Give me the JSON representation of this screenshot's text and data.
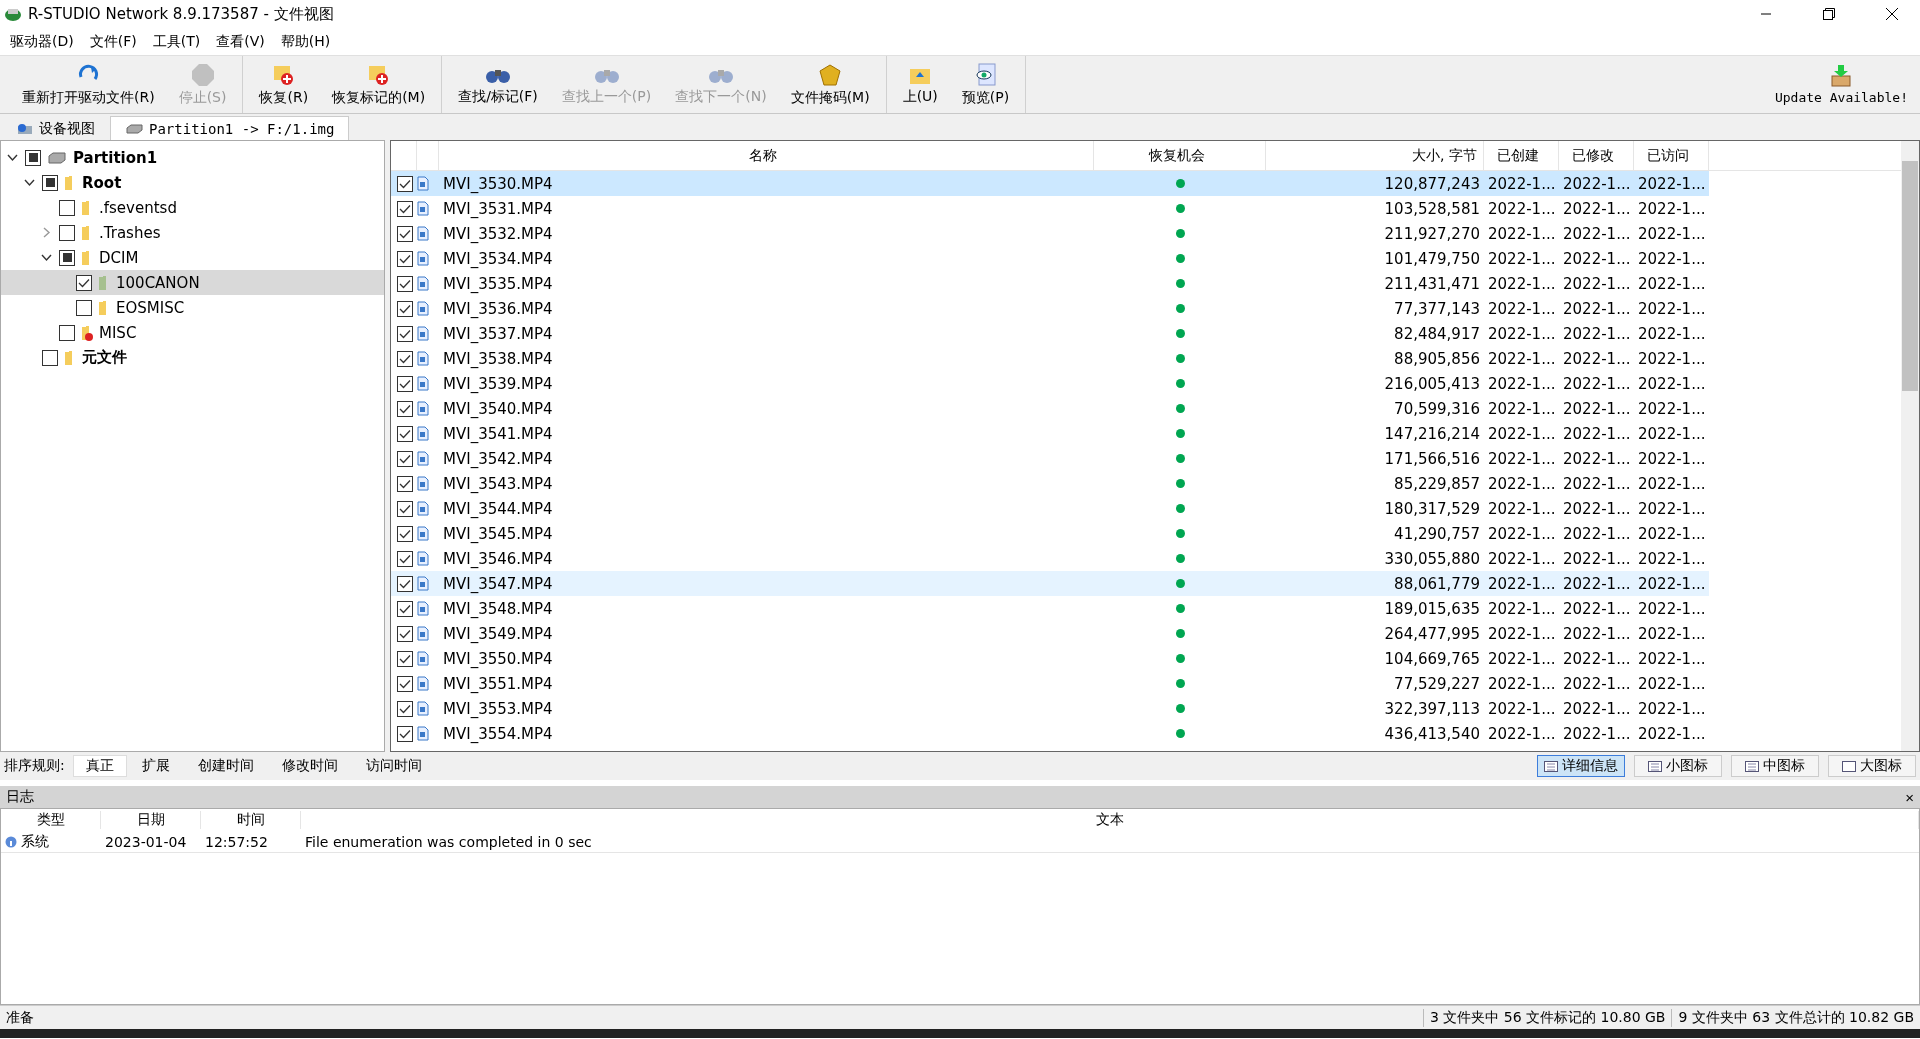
{
  "window": {
    "title": "R-STUDIO Network 8.9.173587 - 文件视图"
  },
  "menu": [
    "驱动器(D)",
    "文件(F)",
    "工具(T)",
    "查看(V)",
    "帮助(H)"
  ],
  "toolbar": [
    [
      {
        "label": "重新打开驱动文件(R)",
        "disabled": false
      },
      {
        "label": "停止(S)",
        "disabled": true
      }
    ],
    [
      {
        "label": "恢复(R)",
        "disabled": false
      },
      {
        "label": "恢复标记的(M)",
        "disabled": false
      }
    ],
    [
      {
        "label": "查找/标记(F)",
        "disabled": false
      },
      {
        "label": "查找上一个(P)",
        "disabled": true
      },
      {
        "label": "查找下一个(N)",
        "disabled": true
      },
      {
        "label": "文件掩码(M)",
        "disabled": false
      }
    ],
    [
      {
        "label": "上(U)",
        "disabled": false
      },
      {
        "label": "预览(P)",
        "disabled": false
      }
    ]
  ],
  "update": {
    "label": "Update Available!"
  },
  "tabs": [
    {
      "label": "设备视图",
      "selected": false
    },
    {
      "label": "Partition1 -> F:/1.img",
      "selected": true
    }
  ],
  "tree": [
    {
      "label": "Partition1",
      "bold": true,
      "kind": "drive",
      "checked": false,
      "partial": true,
      "expanded": true,
      "selected": false,
      "children": [
        {
          "label": "Root",
          "bold": true,
          "kind": "folder",
          "checked": false,
          "partial": true,
          "expanded": true,
          "selected": false,
          "children": [
            {
              "label": ".fseventsd",
              "bold": false,
              "kind": "folder",
              "checked": false,
              "partial": false,
              "selected": false
            },
            {
              "label": ".Trashes",
              "bold": false,
              "kind": "folder",
              "checked": false,
              "partial": false,
              "expanded": false,
              "selected": false
            },
            {
              "label": "DCIM",
              "bold": false,
              "kind": "folder",
              "checked": false,
              "partial": true,
              "expanded": true,
              "selected": false,
              "children": [
                {
                  "label": "100CANON",
                  "bold": false,
                  "kind": "folder-green",
                  "checked": true,
                  "partial": false,
                  "selected": true
                },
                {
                  "label": "EOSMISC",
                  "bold": false,
                  "kind": "folder",
                  "checked": false,
                  "partial": false,
                  "selected": false
                }
              ]
            },
            {
              "label": "MISC",
              "bold": false,
              "kind": "folder-unknown",
              "checked": false,
              "partial": false,
              "selected": false
            }
          ]
        },
        {
          "label": "元文件",
          "bold": true,
          "kind": "folder",
          "checked": false,
          "partial": false,
          "selected": false
        }
      ]
    }
  ],
  "table": {
    "columns": [
      "名称",
      "恢复机会",
      "大小, 字节",
      "已创建",
      "已修改",
      "已访问"
    ],
    "rows": [
      {
        "name": "MVI_3530.MP4",
        "color": "#00a651",
        "size": "120,877,243",
        "created": "2022-1...",
        "modified": "2022-1...",
        "accessed": "2022-1...",
        "checked": true,
        "selected": true,
        "highlighted": false
      },
      {
        "name": "MVI_3531.MP4",
        "color": "#00a651",
        "size": "103,528,581",
        "created": "2022-1...",
        "modified": "2022-1...",
        "accessed": "2022-1...",
        "checked": true,
        "selected": false,
        "highlighted": false
      },
      {
        "name": "MVI_3532.MP4",
        "color": "#00a651",
        "size": "211,927,270",
        "created": "2022-1...",
        "modified": "2022-1...",
        "accessed": "2022-1...",
        "checked": true,
        "selected": false,
        "highlighted": false
      },
      {
        "name": "MVI_3534.MP4",
        "color": "#00a651",
        "size": "101,479,750",
        "created": "2022-1...",
        "modified": "2022-1...",
        "accessed": "2022-1...",
        "checked": true,
        "selected": false,
        "highlighted": false
      },
      {
        "name": "MVI_3535.MP4",
        "color": "#00a651",
        "size": "211,431,471",
        "created": "2022-1...",
        "modified": "2022-1...",
        "accessed": "2022-1...",
        "checked": true,
        "selected": false,
        "highlighted": false
      },
      {
        "name": "MVI_3536.MP4",
        "color": "#00a651",
        "size": "77,377,143",
        "created": "2022-1...",
        "modified": "2022-1...",
        "accessed": "2022-1...",
        "checked": true,
        "selected": false,
        "highlighted": false
      },
      {
        "name": "MVI_3537.MP4",
        "color": "#00a651",
        "size": "82,484,917",
        "created": "2022-1...",
        "modified": "2022-1...",
        "accessed": "2022-1...",
        "checked": true,
        "selected": false,
        "highlighted": false
      },
      {
        "name": "MVI_3538.MP4",
        "color": "#00a651",
        "size": "88,905,856",
        "created": "2022-1...",
        "modified": "2022-1...",
        "accessed": "2022-1...",
        "checked": true,
        "selected": false,
        "highlighted": false
      },
      {
        "name": "MVI_3539.MP4",
        "color": "#00a651",
        "size": "216,005,413",
        "created": "2022-1...",
        "modified": "2022-1...",
        "accessed": "2022-1...",
        "checked": true,
        "selected": false,
        "highlighted": false
      },
      {
        "name": "MVI_3540.MP4",
        "color": "#00a651",
        "size": "70,599,316",
        "created": "2022-1...",
        "modified": "2022-1...",
        "accessed": "2022-1...",
        "checked": true,
        "selected": false,
        "highlighted": false
      },
      {
        "name": "MVI_3541.MP4",
        "color": "#00a651",
        "size": "147,216,214",
        "created": "2022-1...",
        "modified": "2022-1...",
        "accessed": "2022-1...",
        "checked": true,
        "selected": false,
        "highlighted": false
      },
      {
        "name": "MVI_3542.MP4",
        "color": "#00a651",
        "size": "171,566,516",
        "created": "2022-1...",
        "modified": "2022-1...",
        "accessed": "2022-1...",
        "checked": true,
        "selected": false,
        "highlighted": false
      },
      {
        "name": "MVI_3543.MP4",
        "color": "#00a651",
        "size": "85,229,857",
        "created": "2022-1...",
        "modified": "2022-1...",
        "accessed": "2022-1...",
        "checked": true,
        "selected": false,
        "highlighted": false
      },
      {
        "name": "MVI_3544.MP4",
        "color": "#00a651",
        "size": "180,317,529",
        "created": "2022-1...",
        "modified": "2022-1...",
        "accessed": "2022-1...",
        "checked": true,
        "selected": false,
        "highlighted": false
      },
      {
        "name": "MVI_3545.MP4",
        "color": "#00a651",
        "size": "41,290,757",
        "created": "2022-1...",
        "modified": "2022-1...",
        "accessed": "2022-1...",
        "checked": true,
        "selected": false,
        "highlighted": false
      },
      {
        "name": "MVI_3546.MP4",
        "color": "#00a651",
        "size": "330,055,880",
        "created": "2022-1...",
        "modified": "2022-1...",
        "accessed": "2022-1...",
        "checked": true,
        "selected": false,
        "highlighted": false
      },
      {
        "name": "MVI_3547.MP4",
        "color": "#00a651",
        "size": "88,061,779",
        "created": "2022-1...",
        "modified": "2022-1...",
        "accessed": "2022-1...",
        "checked": true,
        "selected": false,
        "highlighted": true
      },
      {
        "name": "MVI_3548.MP4",
        "color": "#00a651",
        "size": "189,015,635",
        "created": "2022-1...",
        "modified": "2022-1...",
        "accessed": "2022-1...",
        "checked": true,
        "selected": false,
        "highlighted": false
      },
      {
        "name": "MVI_3549.MP4",
        "color": "#00a651",
        "size": "264,477,995",
        "created": "2022-1...",
        "modified": "2022-1...",
        "accessed": "2022-1...",
        "checked": true,
        "selected": false,
        "highlighted": false
      },
      {
        "name": "MVI_3550.MP4",
        "color": "#00a651",
        "size": "104,669,765",
        "created": "2022-1...",
        "modified": "2022-1...",
        "accessed": "2022-1...",
        "checked": true,
        "selected": false,
        "highlighted": false
      },
      {
        "name": "MVI_3551.MP4",
        "color": "#00a651",
        "size": "77,529,227",
        "created": "2022-1...",
        "modified": "2022-1...",
        "accessed": "2022-1...",
        "checked": true,
        "selected": false,
        "highlighted": false
      },
      {
        "name": "MVI_3553.MP4",
        "color": "#00a651",
        "size": "322,397,113",
        "created": "2022-1...",
        "modified": "2022-1...",
        "accessed": "2022-1...",
        "checked": true,
        "selected": false,
        "highlighted": false
      },
      {
        "name": "MVI_3554.MP4",
        "color": "#00a651",
        "size": "436,413,540",
        "created": "2022-1...",
        "modified": "2022-1...",
        "accessed": "2022-1...",
        "checked": true,
        "selected": false,
        "highlighted": false
      }
    ]
  },
  "sort": {
    "label": "排序规则:",
    "options": [
      {
        "label": "真正",
        "selected": true
      },
      {
        "label": "扩展",
        "selected": false
      },
      {
        "label": "创建时间",
        "selected": false
      },
      {
        "label": "修改时间",
        "selected": false
      },
      {
        "label": "访问时间",
        "selected": false
      }
    ]
  },
  "views": [
    {
      "label": "详细信息",
      "selected": true
    },
    {
      "label": "小图标",
      "selected": false
    },
    {
      "label": "中图标",
      "selected": false
    },
    {
      "label": "大图标",
      "selected": false
    }
  ],
  "log": {
    "title": "日志",
    "close": "×",
    "columns": [
      "类型",
      "日期",
      "时间",
      "文本"
    ],
    "rows": [
      {
        "type": "系统",
        "date": "2023-01-04",
        "time": "12:57:52",
        "text": "File enumeration was completed in 0 sec"
      }
    ]
  },
  "status_bar": {
    "left": "准备",
    "marked": "3 文件夹中 56 文件标记的 10.80 GB",
    "total": "9 文件夹中 63 文件总计的 10.82 GB"
  }
}
